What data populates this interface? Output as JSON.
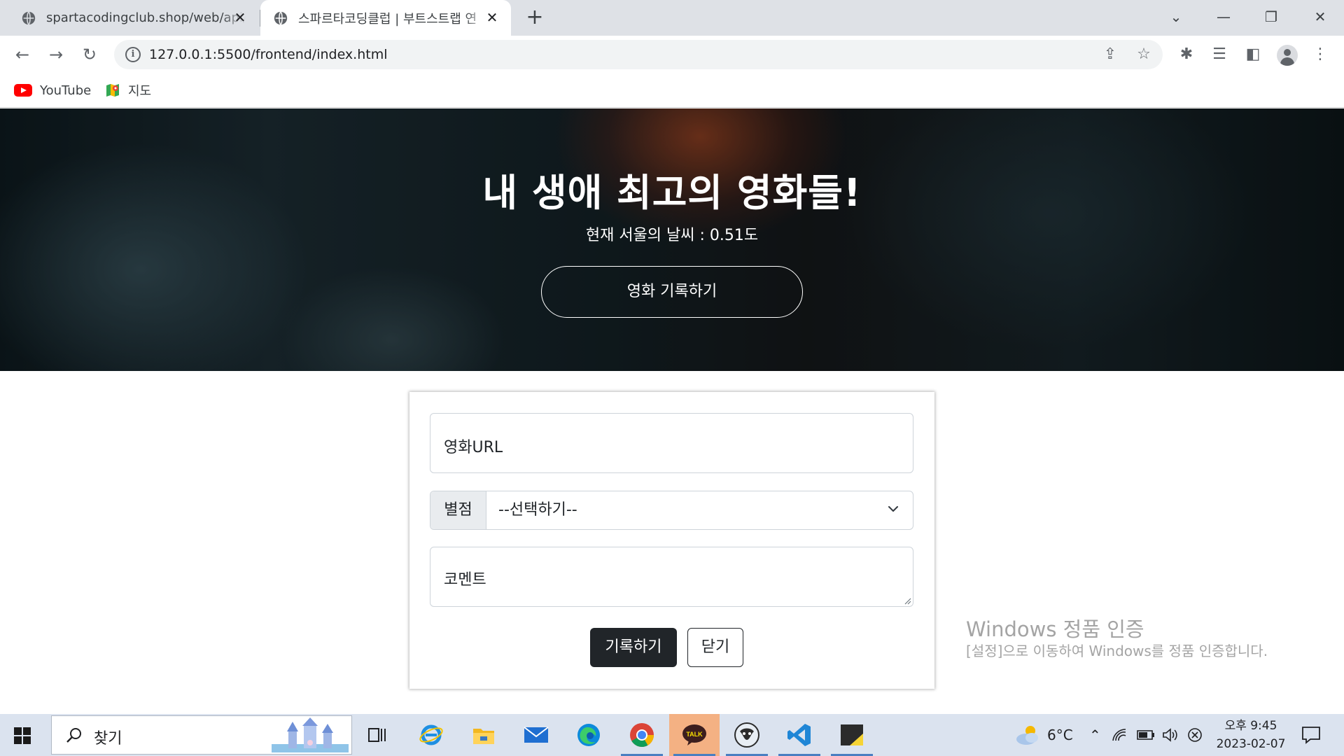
{
  "browser": {
    "tabs": [
      {
        "title": "spartacodingclub.shop/web/api/",
        "active": false
      },
      {
        "title": "스파르타코딩클럽 | 부트스트랩 연",
        "active": true
      }
    ],
    "address": "127.0.0.1:5500/frontend/index.html",
    "bookmarks": [
      {
        "label": "YouTube",
        "icon": "youtube-icon"
      },
      {
        "label": "지도",
        "icon": "maps-icon"
      }
    ]
  },
  "hero": {
    "title": "내 생애 최고의 영화들!",
    "weather": "현재 서울의 날씨 : 0.51도",
    "record_button": "영화 기록하기"
  },
  "form": {
    "url_placeholder": "영화URL",
    "star_label": "별점",
    "star_selected": "--선택하기--",
    "comment_placeholder": "코멘트",
    "save_button": "기록하기",
    "close_button": "닫기"
  },
  "watermark": {
    "title": "Windows 정품 인증",
    "description": "[설정]으로 이동하여 Windows를 정품 인증합니다."
  },
  "taskbar": {
    "search_placeholder": "찾기",
    "weather_temp": "6°C",
    "time": "오후 9:45",
    "date": "2023-02-07"
  },
  "colors": {
    "primary_dark": "#212529",
    "kakao_highlight": "#f4b183",
    "taskbar_bg": "#dbe3ef",
    "tabstrip_bg": "#dee1e6"
  }
}
